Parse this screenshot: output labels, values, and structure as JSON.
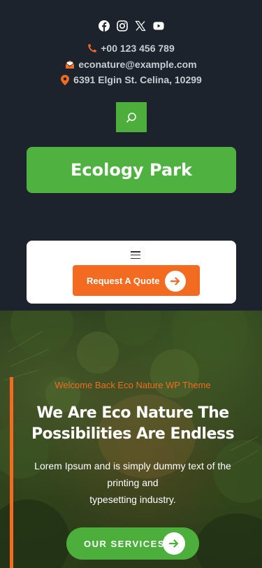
{
  "socials": [
    {
      "icon": "facebook-icon"
    },
    {
      "icon": "instagram-icon"
    },
    {
      "icon": "x-twitter-icon"
    },
    {
      "icon": "youtube-icon"
    }
  ],
  "contact": {
    "phone": "+00 123 456 789",
    "email": "econature@example.com",
    "address": "6391 Elgin St. Celina, 10299"
  },
  "logo": {
    "text": "Ecology Park"
  },
  "nav": {
    "quote_label": "Request A Quote"
  },
  "hero": {
    "eyebrow": "Welcome Back Eco Nature WP Theme",
    "title_line1": "We Are Eco Nature The",
    "title_line2": "Possibilities Are Endless",
    "text_line1": "Lorem Ipsum and is simply dummy text of the",
    "text_line2": "printing and",
    "text_line3": "typesetting industry.",
    "cta_label": "OUR SERVICES"
  },
  "colors": {
    "background": "#1c232c",
    "accent_green": "#4caf3c",
    "accent_orange": "#f26b21"
  }
}
